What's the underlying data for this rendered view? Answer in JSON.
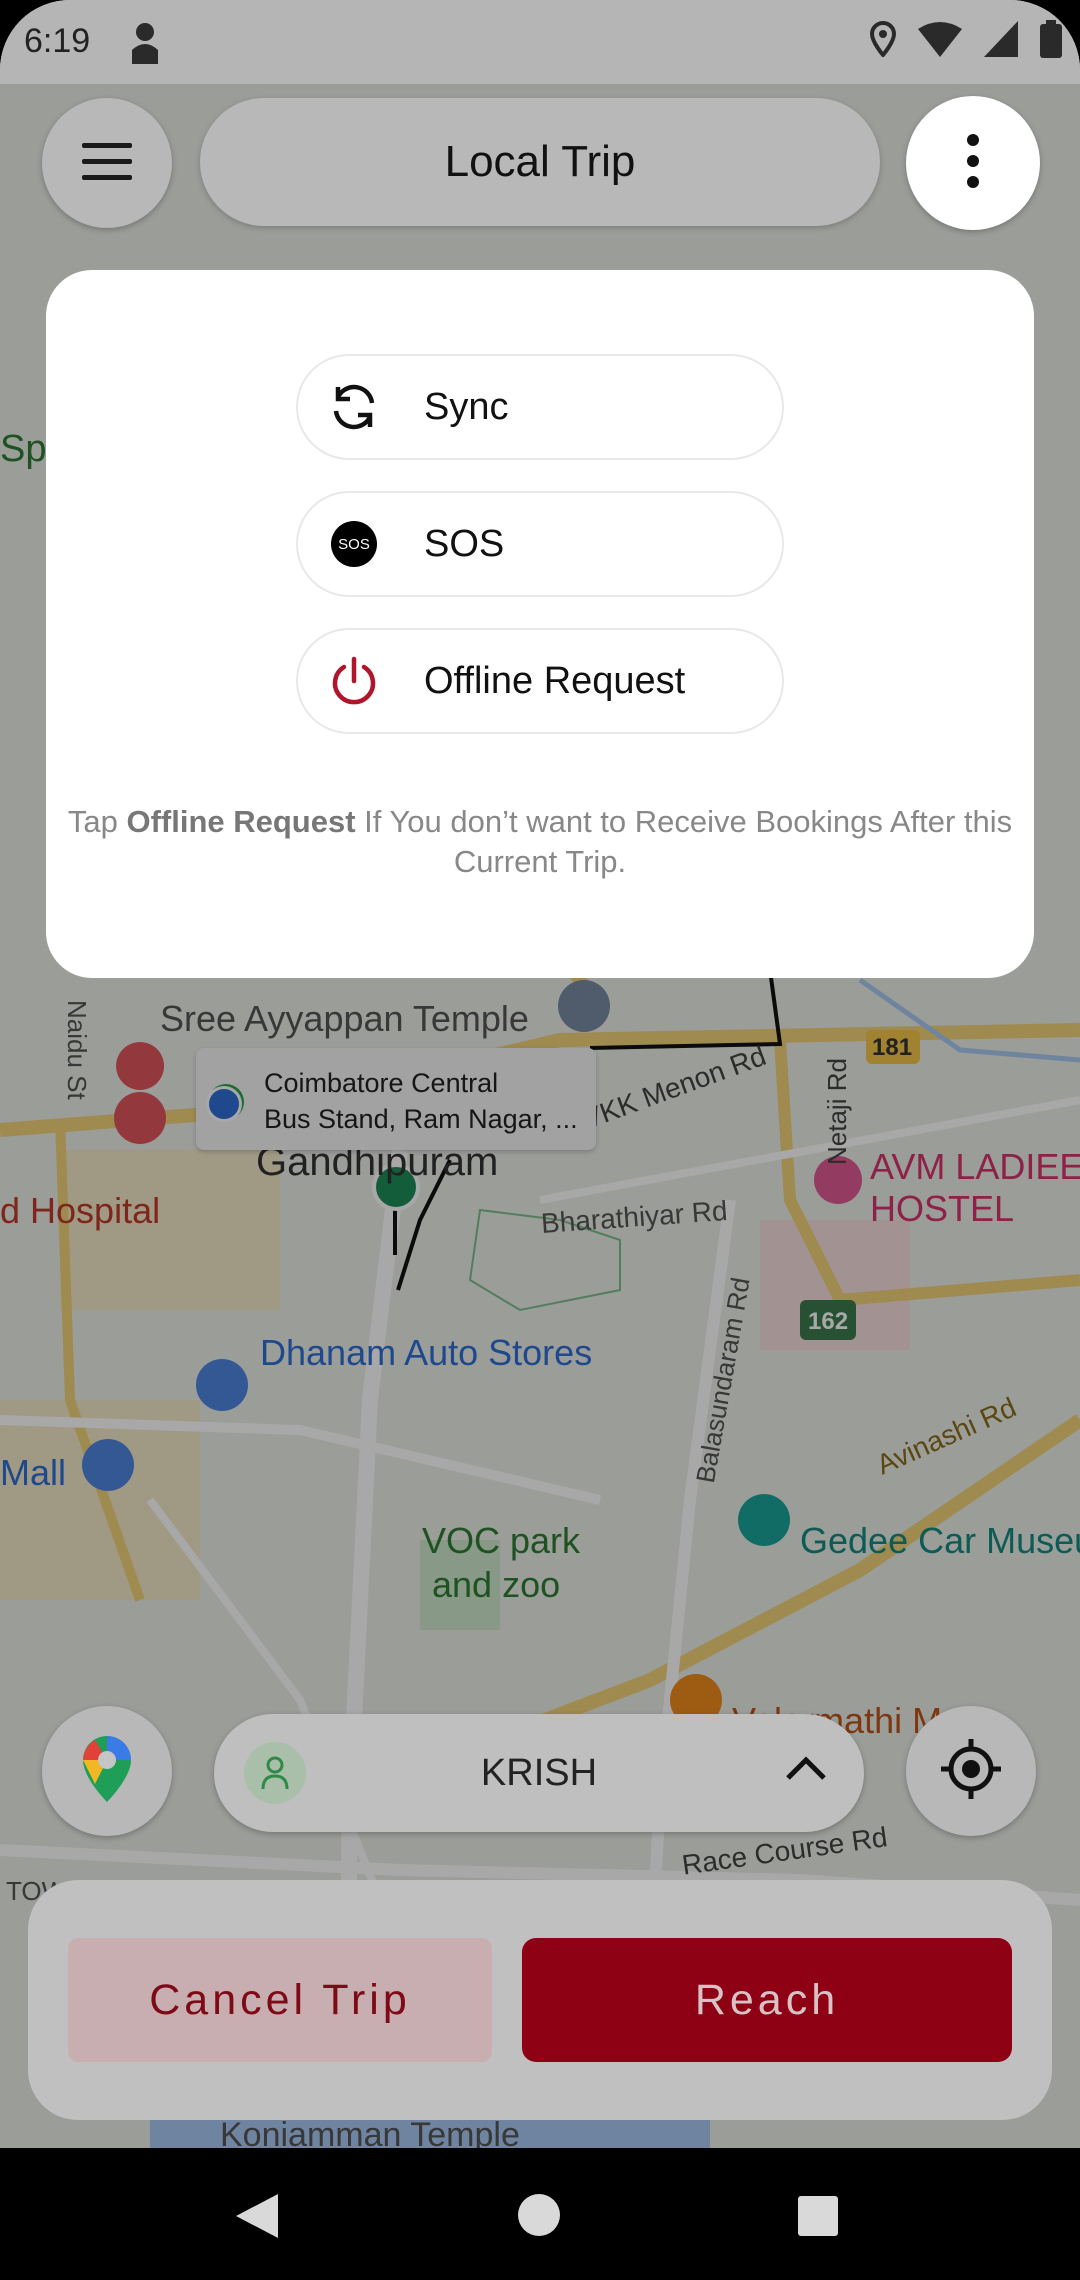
{
  "status_bar": {
    "time": "6:19"
  },
  "header": {
    "title": "Local Trip"
  },
  "popup": {
    "items": [
      {
        "label": "Sync",
        "icon": "sync-icon"
      },
      {
        "label": "SOS",
        "icon": "sos-icon",
        "icon_text": "SOS"
      },
      {
        "label": "Offline Request",
        "icon": "power-icon"
      }
    ],
    "note_prefix": "Tap ",
    "note_bold": "Offline Request",
    "note_suffix": " If You don’t want to Receive Bookings After this Current Trip."
  },
  "map": {
    "labels": {
      "temple": "Sree Ayyappan Temple",
      "gandhipuram": "Gandhipuram",
      "hospital": "d Hospital",
      "vkk": "VKK Menon Rd",
      "bharathiyar": "Bharathiyar Rd",
      "netaji": "Netaji Rd",
      "balasundaram": "Balasundaram Rd",
      "avm": "AVM LADIEE",
      "hostel": "HOSTEL",
      "dhanam": "Dhanam Auto Stores",
      "mall": "Mall",
      "voc1": "VOC park",
      "voc2": "and zoo",
      "gedee": "Gedee Car Museu",
      "avinashi": "Avinashi Rd",
      "velarmathi": "Velarmathi M",
      "race": "Race Course Rd",
      "town": "TOWN HALL",
      "koniamman": "Koniamman Temple",
      "naidu": "Naidu St",
      "sp": "Sp",
      "road181": "181",
      "road162": "162"
    },
    "callout": {
      "line1": "Coimbatore Central",
      "line2": "Bus Stand, Ram Nagar, ..."
    }
  },
  "driver": {
    "name": "KRISH"
  },
  "actions": {
    "cancel": "Cancel Trip",
    "reach": "Reach"
  },
  "colors": {
    "brand": "#8e0013",
    "cancel_bg": "#c8aeb1",
    "popup_bg": "#ffffff"
  }
}
